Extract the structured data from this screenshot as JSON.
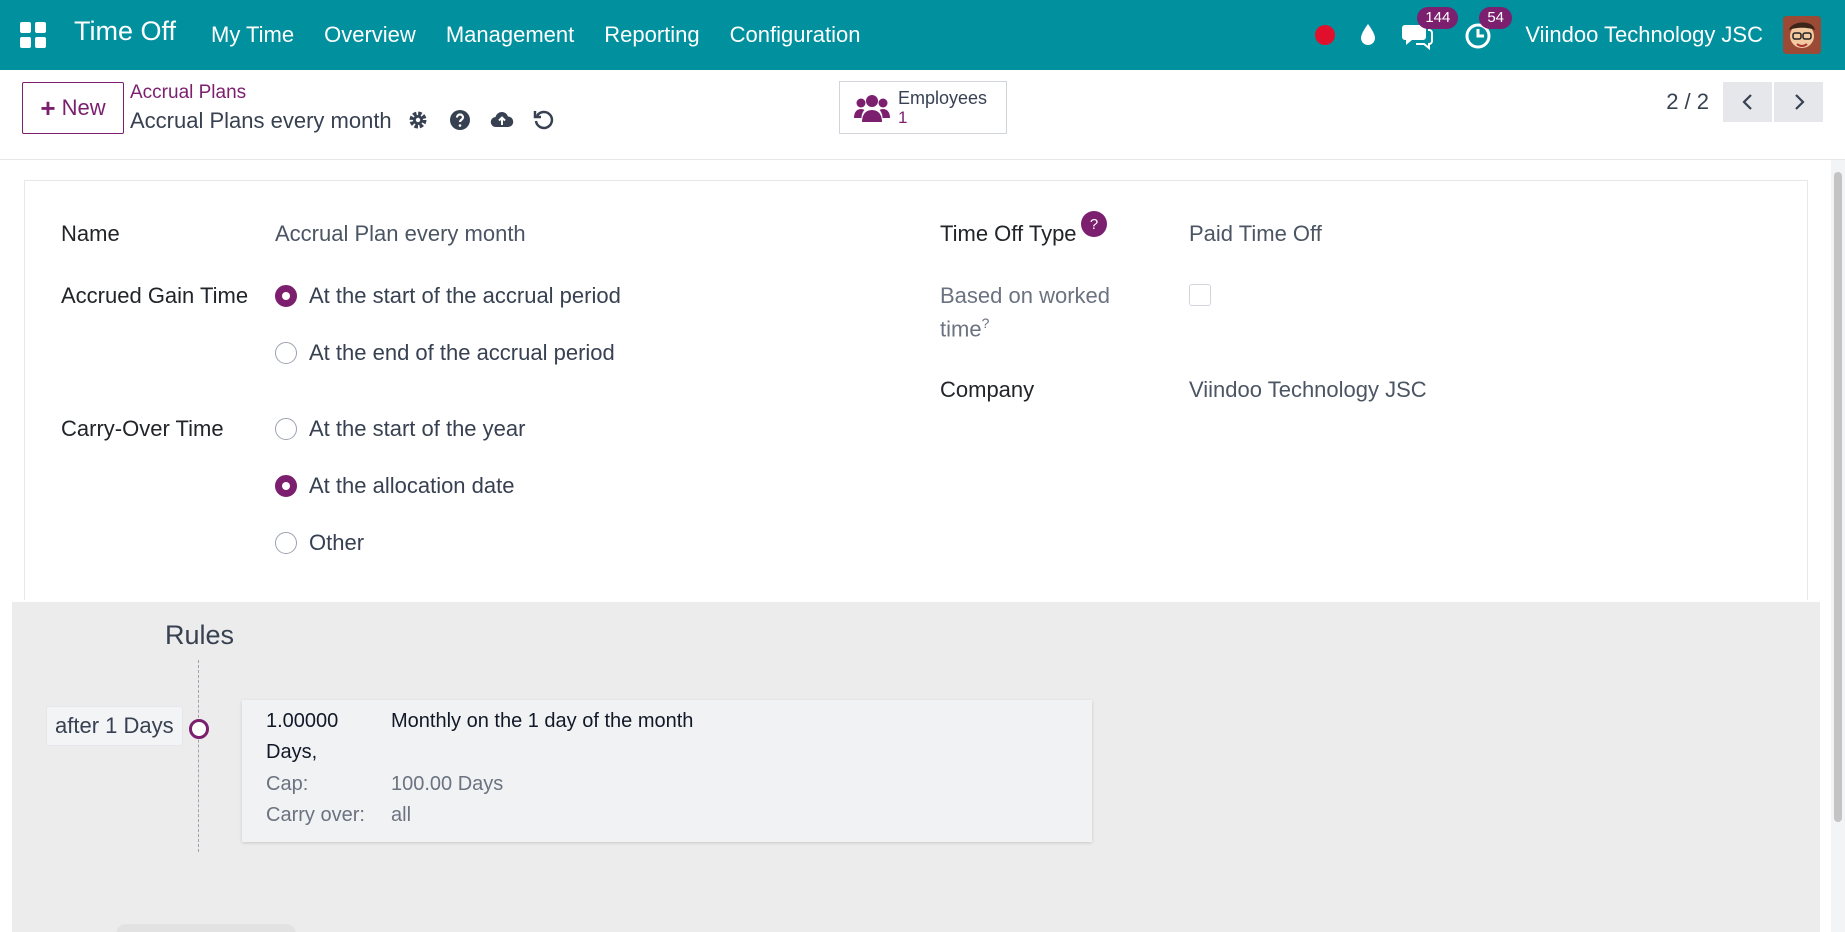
{
  "navbar": {
    "brand": "Time Off",
    "menu": [
      "My Time",
      "Overview",
      "Management",
      "Reporting",
      "Configuration"
    ],
    "messages_count": "144",
    "activities_count": "54",
    "company": "Viindoo Technology JSC"
  },
  "control": {
    "new_label": "New",
    "breadcrumb_parent": "Accrual Plans",
    "breadcrumb_current": "Accrual Plans every month",
    "employees_label": "Employees",
    "employees_count": "1",
    "pager": "2 / 2"
  },
  "form": {
    "name_label": "Name",
    "name_value": "Accrual Plan every month",
    "gain_label": "Accrued Gain Time",
    "gain_options": [
      "At the start of the accrual period",
      "At the end of the accrual period"
    ],
    "gain_selected": 0,
    "carry_label": "Carry-Over Time",
    "carry_options": [
      "At the start of the year",
      "At the allocation date",
      "Other"
    ],
    "carry_selected": 1,
    "type_label": "Time Off Type",
    "type_help": "?",
    "type_value": "Paid Time Off",
    "worked_label_1": "Based on worked",
    "worked_label_2": "time",
    "worked_help": "?",
    "company_label": "Company",
    "company_value": "Viindoo Technology JSC"
  },
  "rules": {
    "title": "Rules",
    "items": [
      {
        "after": "after 1 Days",
        "amount": "1.00000",
        "unit": "Days,",
        "frequency": "Monthly on the 1 day of the month",
        "cap_label": "Cap:",
        "cap_value": "100.00 Days",
        "carry_label": "Carry over:",
        "carry_value": "all"
      }
    ]
  },
  "colors": {
    "navbar": "#00909e",
    "accent": "#7b1f6e"
  }
}
